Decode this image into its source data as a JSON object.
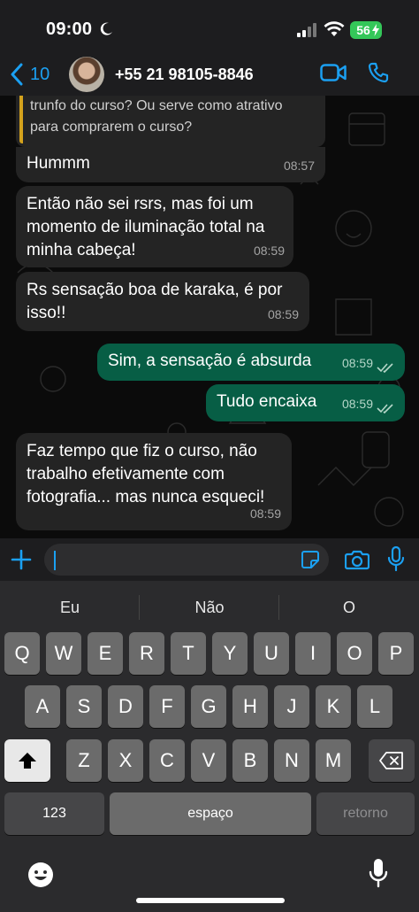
{
  "status_bar": {
    "time": "09:00",
    "battery": "56"
  },
  "header": {
    "back_count": "10",
    "contact": "+55 21 98105-8846"
  },
  "chat": {
    "quoted_text": "trunfo do curso? Ou serve como atrativo para comprarem o curso?",
    "messages": [
      {
        "dir": "in",
        "text": "Hummm",
        "time": "08:57"
      },
      {
        "dir": "in",
        "text": "Então não sei rsrs, mas foi um momento de iluminação total na minha cabeça!",
        "time": "08:59"
      },
      {
        "dir": "in",
        "text": "Rs sensação boa de karaka, é por isso!!",
        "time": "08:59"
      },
      {
        "dir": "out",
        "text": "Sim, a sensação é absurda",
        "time": "08:59"
      },
      {
        "dir": "out",
        "text": "Tudo encaixa",
        "time": "08:59"
      },
      {
        "dir": "in",
        "text": "Faz tempo que fiz o curso, não trabalho efetivamente com fotografia... mas nunca esqueci!",
        "time": "08:59"
      }
    ]
  },
  "keyboard": {
    "suggestions": [
      "Eu",
      "Não",
      "O"
    ],
    "row1": [
      "Q",
      "W",
      "E",
      "R",
      "T",
      "Y",
      "U",
      "I",
      "O",
      "P"
    ],
    "row2": [
      "A",
      "S",
      "D",
      "F",
      "G",
      "H",
      "J",
      "K",
      "L"
    ],
    "row3": [
      "Z",
      "X",
      "C",
      "V",
      "B",
      "N",
      "M"
    ],
    "numbers_key": "123",
    "space_key": "espaço",
    "return_key": "retorno"
  },
  "colors": {
    "accent": "#1ba0f2",
    "outgoing_bubble": "#075e45",
    "incoming_bubble": "#242424"
  },
  "icons": [
    "moon-icon",
    "signal-icon",
    "wifi-icon",
    "bolt-icon",
    "chevron-left-icon",
    "video-icon",
    "phone-icon",
    "plus-icon",
    "sticker-icon",
    "camera-icon",
    "microphone-icon",
    "shift-icon",
    "delete-icon",
    "emoji-icon",
    "double-check-icon"
  ]
}
